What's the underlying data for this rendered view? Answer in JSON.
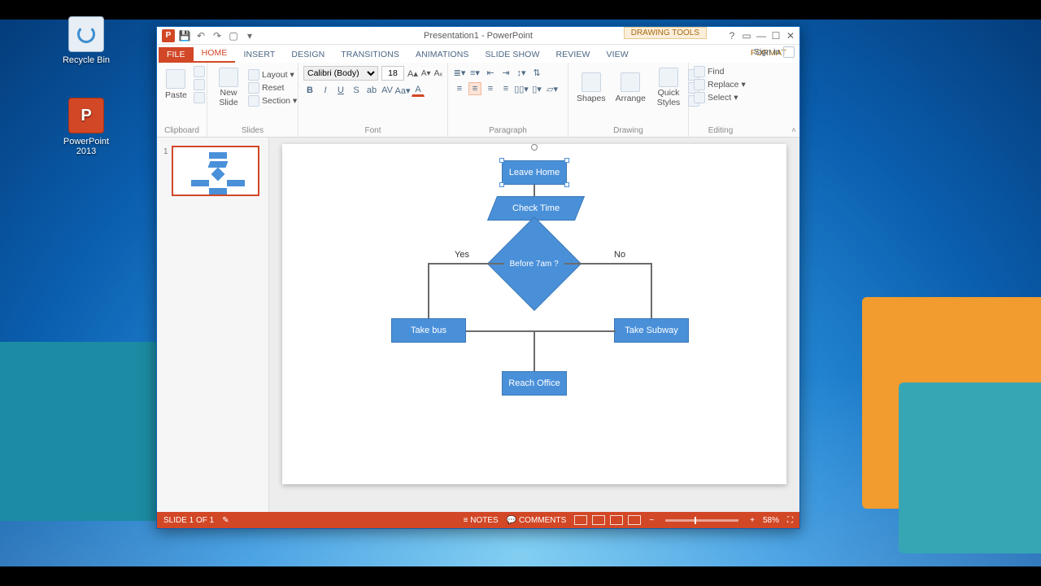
{
  "desktop_icons": {
    "recycle": "Recycle Bin",
    "ppt": "PowerPoint 2013"
  },
  "title": "Presentation1 - PowerPoint",
  "context_title": "DRAWING TOOLS",
  "tabs": {
    "file": "FILE",
    "home": "HOME",
    "insert": "INSERT",
    "design": "DESIGN",
    "transitions": "TRANSITIONS",
    "animations": "ANIMATIONS",
    "slideshow": "SLIDE SHOW",
    "review": "REVIEW",
    "view": "VIEW",
    "format": "FORMAT"
  },
  "signin": "Sign in",
  "ribbon": {
    "clipboard": {
      "label": "Clipboard",
      "paste": "Paste"
    },
    "slides": {
      "label": "Slides",
      "new": "New Slide",
      "layout": "Layout",
      "reset": "Reset",
      "section": "Section"
    },
    "font": {
      "label": "Font",
      "name": "Calibri (Body)",
      "size": "18"
    },
    "paragraph": {
      "label": "Paragraph"
    },
    "drawing": {
      "label": "Drawing",
      "shapes": "Shapes",
      "arrange": "Arrange",
      "quick": "Quick Styles"
    },
    "editing": {
      "label": "Editing",
      "find": "Find",
      "replace": "Replace",
      "select": "Select"
    }
  },
  "thumb_index": "1",
  "flow": {
    "leave": "Leave Home",
    "check": "Check Time",
    "decision": "Before 7am ?",
    "yes": "Yes",
    "no": "No",
    "bus": "Take bus",
    "subway": "Take Subway",
    "reach": "Reach Office"
  },
  "status": {
    "slide": "SLIDE 1 OF 1",
    "notes": "NOTES",
    "comments": "COMMENTS",
    "zoom": "58%"
  }
}
